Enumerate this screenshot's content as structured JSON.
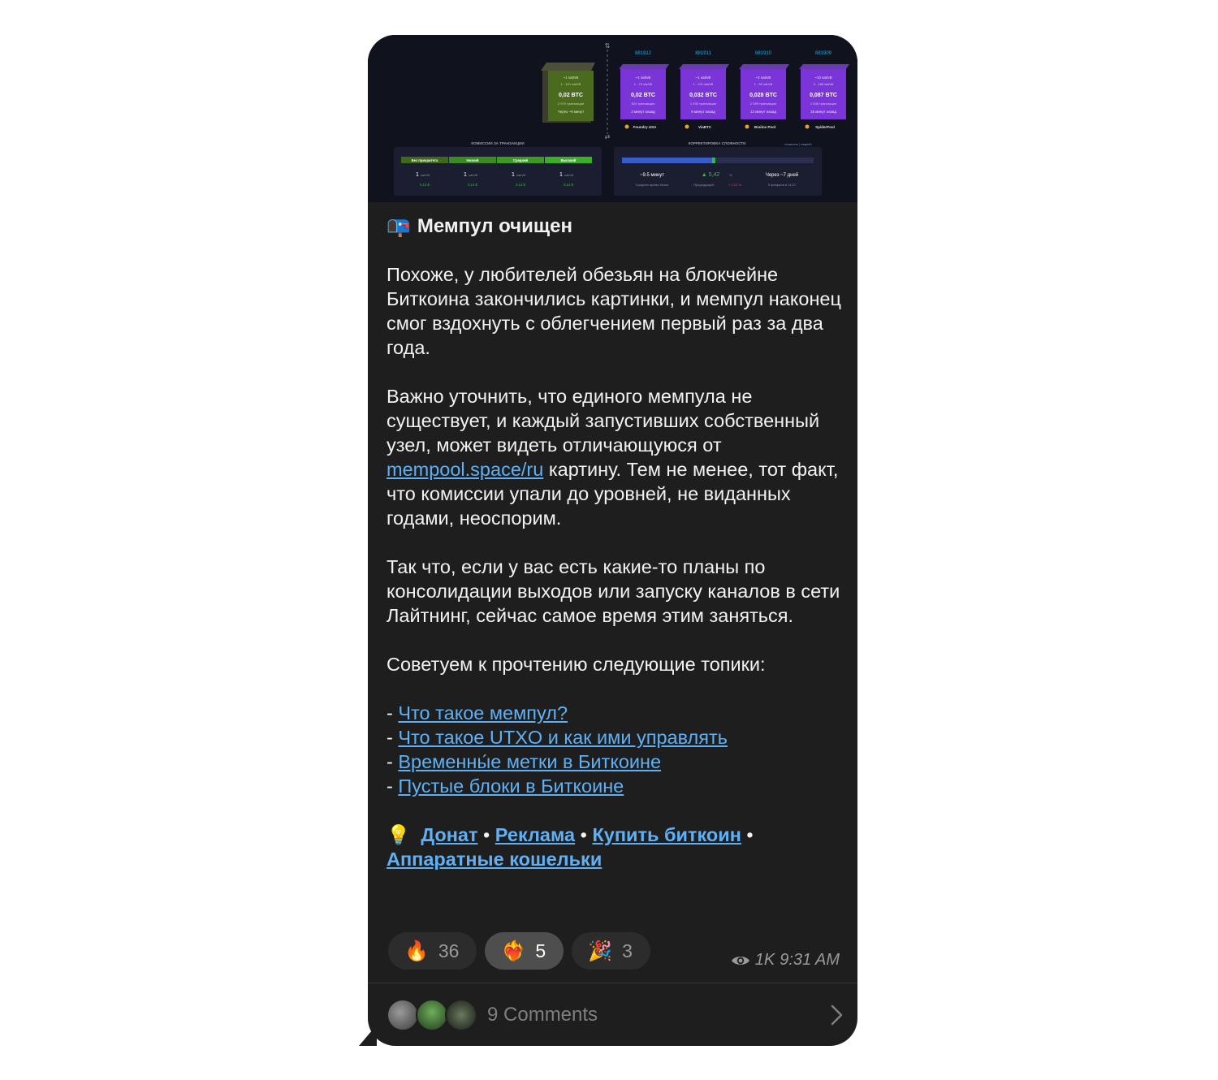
{
  "media": {
    "block_numbers": [
      "881912",
      "881911",
      "881910",
      "881909"
    ],
    "pending_block": {
      "fee": "~1 sat/vB",
      "range": "1 - 101 sat/vB",
      "btc": "0,02 BTC",
      "tx": "2 970 транзакции",
      "eta": "Через ~9 минут"
    },
    "blocks": [
      {
        "fee": "~1 sat/vB",
        "range": "1 - 75 sat/vB",
        "btc": "0,02 BTC",
        "tx": "524 транзакции",
        "ago": "3 минут назад",
        "pool": "Foundry USA"
      },
      {
        "fee": "~1 sat/vB",
        "range": "1 - 101 sat/vB",
        "btc": "0,032 BTC",
        "tx": "1 930 транзакции",
        "ago": "6 минут назад",
        "pool": "ViaBTC"
      },
      {
        "fee": "~2 sat/vB",
        "range": "1 - 50 sat/vB",
        "btc": "0,028 BTC",
        "tx": "2 399 транзакции",
        "ago": "12 минут назад",
        "pool": "Braiins Pool"
      },
      {
        "fee": "~10 sat/vB",
        "range": "3 - 186 sat/vB",
        "btc": "0,087 BTC",
        "tx": "1 636 транзакции",
        "ago": "16 минут назад",
        "pool": "SpiderPool"
      }
    ],
    "fees_title": "КОМИССИИ ЗА ТРАНЗАКЦИИ",
    "fee_tiers": [
      {
        "label": "Без приоритета",
        "value": "1",
        "unit": "sat/vB",
        "usd": "0,14 $"
      },
      {
        "label": "Низкий",
        "value": "1",
        "unit": "sat/vB",
        "usd": "0,14 $"
      },
      {
        "label": "Средний",
        "value": "1",
        "unit": "sat/vB",
        "usd": "0,14 $"
      },
      {
        "label": "Высокий",
        "value": "1",
        "unit": "sat/vB",
        "usd": "0,14 $"
      }
    ],
    "difficulty_title": "КОРРЕКТИРОВКА СЛОЖНОСТИ",
    "difficulty_tabs": "сложность | хэшрейт",
    "difficulty": {
      "avg_time": "~9.5 минут",
      "avg_label": "Среднее время блока",
      "change": "▲ 5,42",
      "change_unit": "%",
      "prev_label": "Предыдущий:",
      "prev": "+ 2,12 %",
      "eta": "Через ~7 дней",
      "date": "9 февраля в 14:27",
      "progress": 0.47
    }
  },
  "post": {
    "title_emoji": "📭",
    "title": "Мемпул очищен",
    "p1": "Похоже, у любителей обезьян на блокчейне Биткоина закончились картинки, и мемпул наконец смог вздохнуть с облегчением первый раз за два года.",
    "p2_before": "Важно уточнить, что единого мемпула не существует, и каждый запустивших собственный узел, может видеть отличающуюся от ",
    "p2_link": "mempool.space/ru",
    "p2_after": " картину. Тем не менее, тот факт, что комиссии упали до уровней, не виданных годами, неоспорим.",
    "p3": "Так что, если у вас есть какие-то планы по консолидации выходов или запуску каналов в сети Лайтнинг, сейчас самое время этим заняться.",
    "p4": "Советуем к прочтению следующие топики:",
    "links": [
      "Что такое мемпул?",
      "Что такое UTXO и как ими управлять",
      "Временны́е метки в Биткоине",
      "Пустые блоки в Биткоине"
    ],
    "footer_emoji": "💡",
    "footer_links": [
      "Донат",
      "Реклама",
      "Купить биткоин",
      "Аппаратные кошельки"
    ]
  },
  "reactions": [
    {
      "emoji": "🔥",
      "count": "36",
      "active": false
    },
    {
      "emoji": "❤️‍🔥",
      "count": "5",
      "active": true
    },
    {
      "emoji": "🎉",
      "count": "3",
      "active": false
    }
  ],
  "meta": {
    "views": "1K",
    "time": "9:31 AM"
  },
  "comments": {
    "label": "9 Comments"
  }
}
